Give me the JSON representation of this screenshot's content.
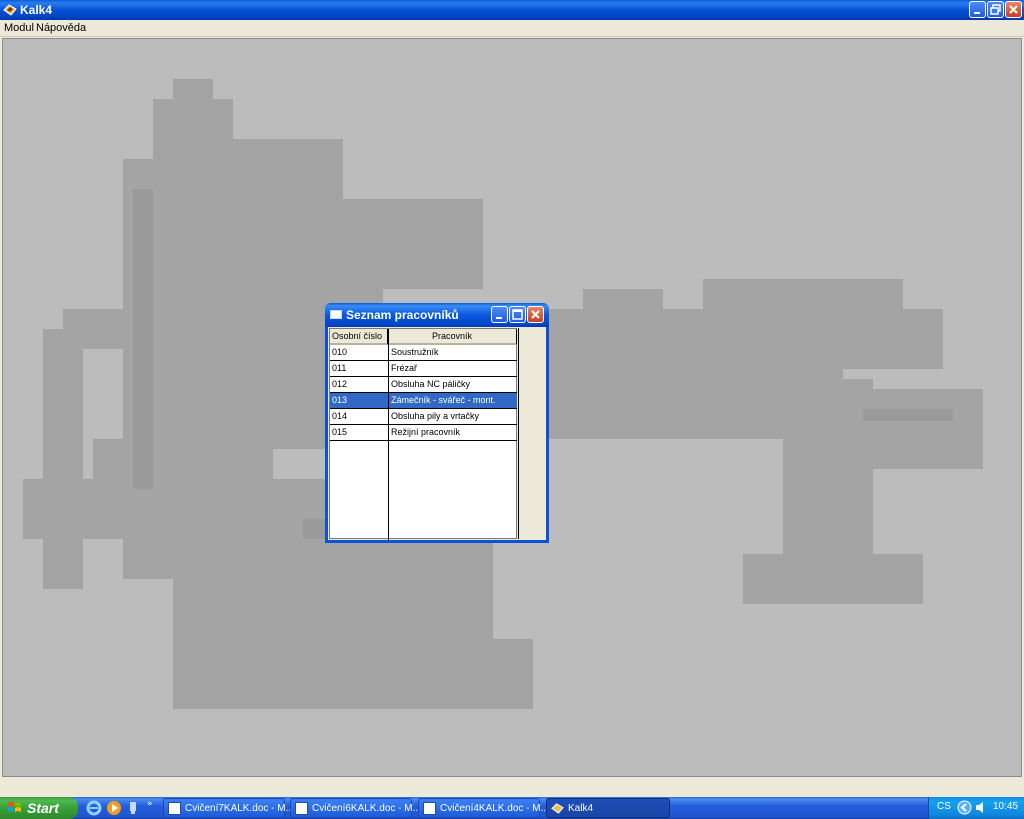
{
  "window": {
    "title": "Kalk4",
    "colors": {
      "titlebar": "#0752d6",
      "background": "#bcbcbc",
      "selection": "#316ac5"
    }
  },
  "menu": {
    "items": [
      {
        "label": "Modul"
      },
      {
        "label": "Nápověda"
      }
    ]
  },
  "dialog": {
    "title": "Seznam pracovníků",
    "columns": [
      "Osobní číslo",
      "Pracovník"
    ],
    "rows": [
      {
        "id": "010",
        "name": "Soustružník"
      },
      {
        "id": "011",
        "name": "Frézař"
      },
      {
        "id": "012",
        "name": "Obsluha NC páličky"
      },
      {
        "id": "013",
        "name": "Zámečník - svářeč - mont."
      },
      {
        "id": "014",
        "name": "Obsluha pily  a vrtačky"
      },
      {
        "id": "015",
        "name": "Režijní pracovník"
      }
    ],
    "selected_row_index": 3
  },
  "taskbar": {
    "start_label": "Start",
    "tasks": [
      {
        "label": "Cvičení7KALK.doc - M...",
        "icon": "word-doc-icon"
      },
      {
        "label": "Cvičení6KALK.doc - M...",
        "icon": "word-doc-icon"
      },
      {
        "label": "Cvičení4KALK.doc - M...",
        "icon": "word-doc-icon"
      },
      {
        "label": "Kalk4",
        "icon": "kalk4-app-icon"
      }
    ],
    "tray": {
      "language": "CS",
      "clock": "10:45"
    }
  }
}
